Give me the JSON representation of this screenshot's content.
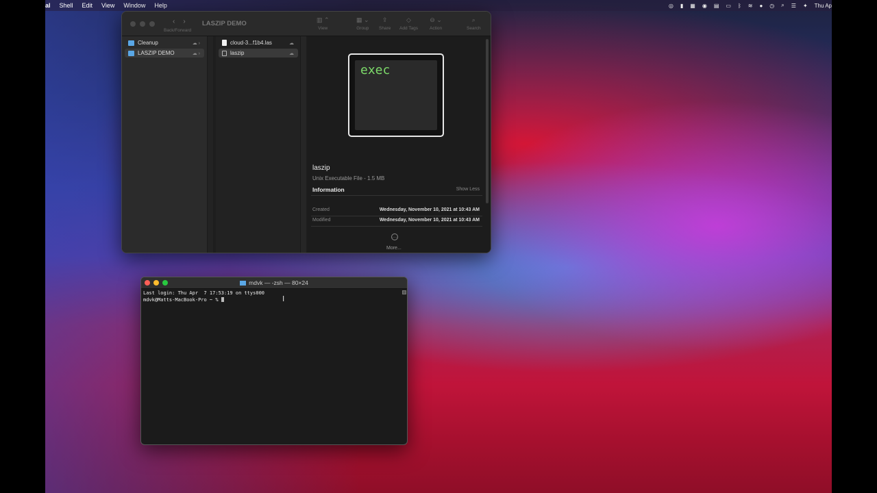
{
  "menubar": {
    "app_partial": "al",
    "menus": [
      "Shell",
      "Edit",
      "View",
      "Window",
      "Help"
    ],
    "clock": "Thu Ap",
    "status_icons": [
      "creative-cloud-icon",
      "battery-small-icon",
      "grid-icon",
      "play-icon",
      "keyboard-icon",
      "battery-icon",
      "bluetooth-icon",
      "wifi-icon",
      "user-icon",
      "time-machine-icon",
      "search-icon",
      "control-center-icon",
      "siri-icon"
    ]
  },
  "finder": {
    "title": "LASZIP DEMO",
    "toolbar": {
      "back_forward": "Back/Forward",
      "view": "View",
      "group": "Group",
      "share": "Share",
      "add_tags": "Add Tags",
      "action": "Action",
      "search": "Search"
    },
    "sidebar": [
      {
        "label": "Cleanup",
        "selected": false
      },
      {
        "label": "LASZIP DEMO",
        "selected": true
      }
    ],
    "files": [
      {
        "label": "cloud-3...f1b4.las",
        "kind": "doc"
      },
      {
        "label": "laszip",
        "kind": "exec",
        "selected": true
      }
    ],
    "preview": {
      "thumb_text": "exec",
      "name": "laszip",
      "kind": "Unix Executable File - 1.5 MB",
      "info_heading": "Information",
      "show_less": "Show Less",
      "created_label": "Created",
      "created_value": "Wednesday, November 10, 2021 at 10:43 AM",
      "modified_label": "Modified",
      "modified_value": "Wednesday, November 10, 2021 at 10:43 AM",
      "more": "More..."
    }
  },
  "terminal": {
    "title": "mdvk — -zsh — 80×24",
    "line1": "Last login: Thu Apr  7 17:53:19 on ttys000",
    "prompt": "mdvk@Matts-MacBook-Pro ~ % "
  }
}
